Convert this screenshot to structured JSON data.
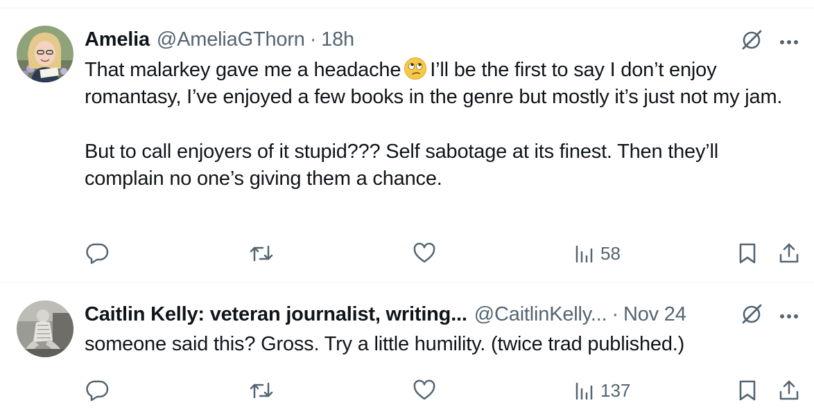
{
  "tweets": [
    {
      "display_name": "Amelia",
      "handle": "@AmeliaGThorn",
      "separator": "·",
      "time": "18h",
      "text_before_emoji": "That malarkey gave me a headache",
      "emoji": "face-with-rolling-eyes",
      "text_after_emoji": "I’ll be the first to say I don’t enjoy romantasy, I’ve enjoyed a few books in the genre but mostly it’s just not my jam.",
      "text_second_paragraph": "But to call enjoyers of it stupid??? Self sabotage at its finest. Then they’ll complain no one’s giving them a chance.",
      "views": "58",
      "icons": [
        "grok-icon",
        "more-icon",
        "reply-icon",
        "retweet-icon",
        "like-icon",
        "views-icon",
        "bookmark-icon",
        "share-icon"
      ]
    },
    {
      "display_name": "Caitlin Kelly: veteran journalist, writing...",
      "handle": "@CaitlinKelly...",
      "separator": "·",
      "time": "Nov 24",
      "text": "someone said this? Gross. Try a little humility. (twice trad published.)",
      "views": "137",
      "icons": [
        "grok-icon",
        "more-icon",
        "reply-icon",
        "retweet-icon",
        "like-icon",
        "views-icon",
        "bookmark-icon",
        "share-icon"
      ]
    }
  ],
  "colors": {
    "text": "#0f1419",
    "secondary": "#536471",
    "divider": "#eff3f4"
  }
}
